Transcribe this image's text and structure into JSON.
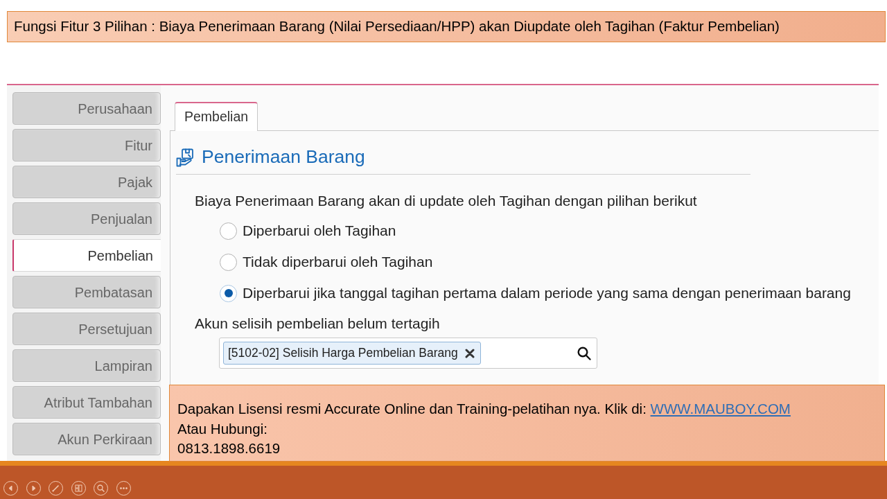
{
  "slide_title": "Fungsi Fitur 3 Pilihan : Biaya Penerimaan Barang (Nilai Persediaan/HPP) akan Diupdate oleh Tagihan (Faktur Pembelian)",
  "sidebar": {
    "items": [
      {
        "label": "Perusahaan",
        "selected": false
      },
      {
        "label": "Fitur",
        "selected": false
      },
      {
        "label": "Pajak",
        "selected": false
      },
      {
        "label": "Penjualan",
        "selected": false
      },
      {
        "label": "Pembelian",
        "selected": true
      },
      {
        "label": "Pembatasan",
        "selected": false
      },
      {
        "label": "Persetujuan",
        "selected": false
      },
      {
        "label": "Lampiran",
        "selected": false
      },
      {
        "label": "Atribut Tambahan",
        "selected": false
      },
      {
        "label": "Akun Perkiraan",
        "selected": false
      }
    ]
  },
  "tabs": [
    {
      "label": "Pembelian",
      "selected": true
    }
  ],
  "section_title": "Penerimaan Barang",
  "update_setting": {
    "label": "Biaya Penerimaan Barang akan di update oleh Tagihan dengan pilihan berikut",
    "options": [
      {
        "label": "Diperbarui oleh Tagihan",
        "selected": false
      },
      {
        "label": "Tidak diperbarui oleh Tagihan",
        "selected": false
      },
      {
        "label": "Diperbarui jika tanggal tagihan pertama dalam periode yang sama dengan penerimaan barang",
        "selected": true
      }
    ]
  },
  "account_field": {
    "label": "Akun selisih pembelian belum tertagih",
    "value": "[5102-02] Selisih Harga Pembelian Barang"
  },
  "promo": {
    "text": "Dapakan Lisensi resmi Accurate Online dan Training-pelatihan nya. Klik di:",
    "link": "WWW.MAUBOY.COM",
    "contact_label": "Atau Hubungi:",
    "phone": "0813.1898.6619"
  }
}
